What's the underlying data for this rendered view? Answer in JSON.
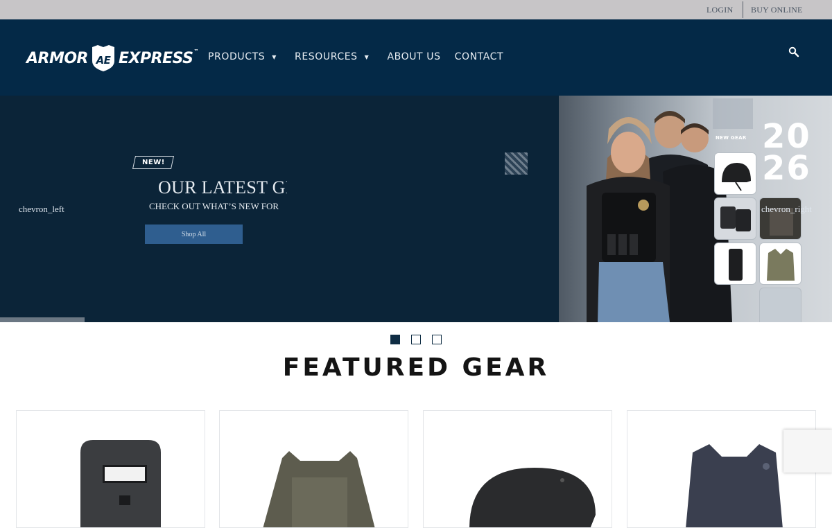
{
  "topbar": {
    "login": "LOGIN",
    "buy_online": "BUY ONLINE"
  },
  "brand": {
    "word1": "ARMOR",
    "monogram": "AE",
    "word2": "EXPRESS",
    "tm": "™"
  },
  "nav": {
    "items": [
      {
        "label": "PRODUCTS",
        "has_dropdown": true
      },
      {
        "label": "RESOURCES",
        "has_dropdown": true
      },
      {
        "label": "ABOUT US",
        "has_dropdown": false
      },
      {
        "label": "CONTACT",
        "has_dropdown": false
      }
    ],
    "caret": "▼"
  },
  "hero": {
    "prev_label": "chevron_left",
    "next_label": "chevron_right",
    "badge": "NEW!",
    "headline": "OUR LATEST GI",
    "subtitle": "CHECK OUT WHAT’S NEW FOR",
    "cta": "Shop All",
    "promo_tag": "NEW GEAR",
    "promo_year_line1": "20",
    "promo_year_line2": "26"
  },
  "slider": {
    "active_index": 0,
    "count": 3
  },
  "featured": {
    "heading": "FEATURED GEAR"
  },
  "colors": {
    "header_bg": "#042947",
    "hero_bg": "#0b2438",
    "cta_bg": "#2f5e8f",
    "topbar_bg": "#c7c5c7"
  },
  "icons": {
    "search": "search-icon",
    "prev": "chevron-left-icon",
    "next": "chevron-right-icon"
  }
}
